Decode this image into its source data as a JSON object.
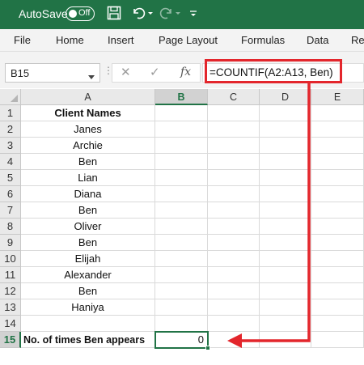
{
  "titlebar": {
    "autosave_label": "AutoSave",
    "autosave_state": "Off",
    "icons": [
      "save-icon",
      "undo-icon",
      "redo-icon",
      "customize-toolbar-icon"
    ]
  },
  "ribbon": {
    "tabs": [
      "File",
      "Home",
      "Insert",
      "Page Layout",
      "Formulas",
      "Data",
      "Re"
    ]
  },
  "formula_bar": {
    "name_box": "B15",
    "formula": "=COUNTIF(A2:A13, Ben)",
    "fx_label": "fx"
  },
  "sheet": {
    "columns": [
      "A",
      "B",
      "C",
      "D",
      "E"
    ],
    "row_numbers": [
      "1",
      "2",
      "3",
      "4",
      "5",
      "6",
      "7",
      "8",
      "9",
      "10",
      "11",
      "12",
      "13",
      "14",
      "15"
    ],
    "colA": [
      "Client Names",
      "Janes",
      "Archie",
      "Ben",
      "Lian",
      "Diana",
      "Ben",
      "Oliver",
      "Ben",
      "Elijah",
      "Alexander",
      "Ben",
      "Haniya",
      "",
      "No. of times Ben appears"
    ],
    "b15_value": "0",
    "active_cell": "B15"
  },
  "colors": {
    "brand": "#217346",
    "annotation": "#e3262c"
  }
}
